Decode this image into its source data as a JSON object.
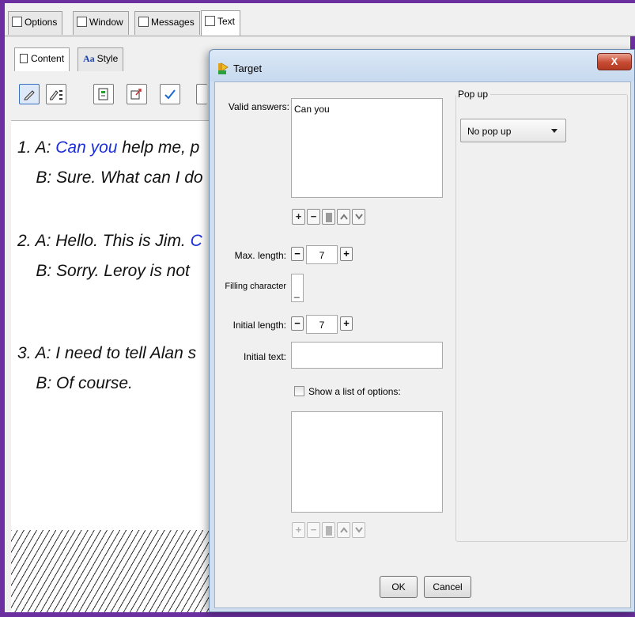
{
  "top_tabs": [
    {
      "label": "Options",
      "icon": "options-icon"
    },
    {
      "label": "Window",
      "icon": "window-icon"
    },
    {
      "label": "Messages",
      "icon": "messages-icon"
    },
    {
      "label": "Text",
      "icon": "text-edit-icon"
    }
  ],
  "sub_tabs": {
    "content": "Content",
    "style_prefix": "Aa",
    "style": "Style"
  },
  "editor": {
    "line1a_pre": "1. A: ",
    "line1a_hl": "Can you",
    "line1a_post": " help me, p",
    "line1b": "    B: Sure. What can I do",
    "line2a_pre": "2. A: Hello. This is Jim. ",
    "line2a_hl": "C",
    "line2b": "    B: Sorry. Leroy is not",
    "line3a": "3. A: I need to tell Alan s",
    "line3b": "    B: Of course."
  },
  "dialog": {
    "title": "Target",
    "close_label": "X",
    "valid_answers_label": "Valid answers:",
    "valid_answers_value": "Can you",
    "max_length_label": "Max. length:",
    "max_length_value": "7",
    "filling_char_label": "Filling character",
    "filling_char_value": "_",
    "initial_length_label": "Initial length:",
    "initial_length_value": "7",
    "initial_text_label": "Initial text:",
    "initial_text_value": "",
    "show_options_label": "Show a list of options:",
    "show_options_checked": false,
    "popup_group_label": "Pop up",
    "popup_selected": "No pop up",
    "ok_label": "OK",
    "cancel_label": "Cancel",
    "plus": "+",
    "minus": "−"
  },
  "colors": {
    "frame": "#6b2fa0",
    "highlight_text": "#1c2fd6",
    "close_button": "#c74a32"
  }
}
